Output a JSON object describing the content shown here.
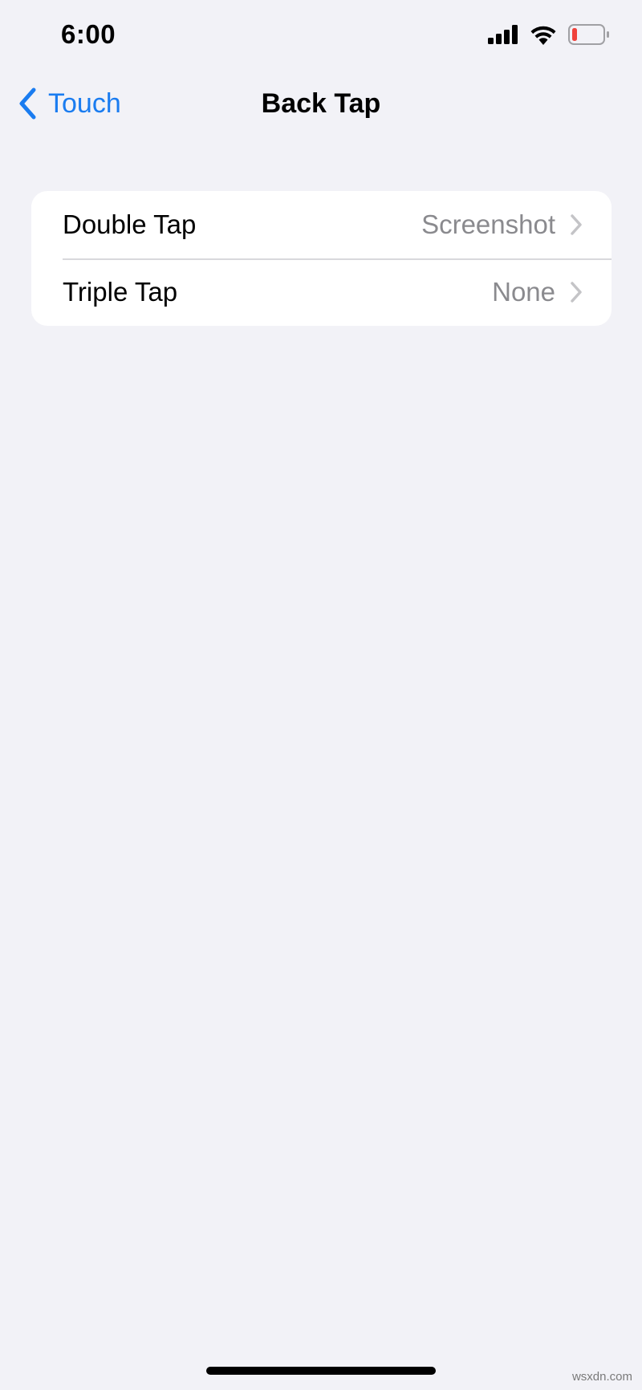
{
  "status_bar": {
    "time": "6:00",
    "icons": [
      "cellular-signal-icon",
      "wifi-icon",
      "battery-low-icon"
    ],
    "battery_color": "#f0423c"
  },
  "nav": {
    "back_label": "Touch",
    "title": "Back Tap",
    "accent_color": "#1a7cf0"
  },
  "settings": {
    "rows": [
      {
        "label": "Double Tap",
        "value": "Screenshot"
      },
      {
        "label": "Triple Tap",
        "value": "None"
      }
    ]
  },
  "watermark": "wsxdn.com"
}
